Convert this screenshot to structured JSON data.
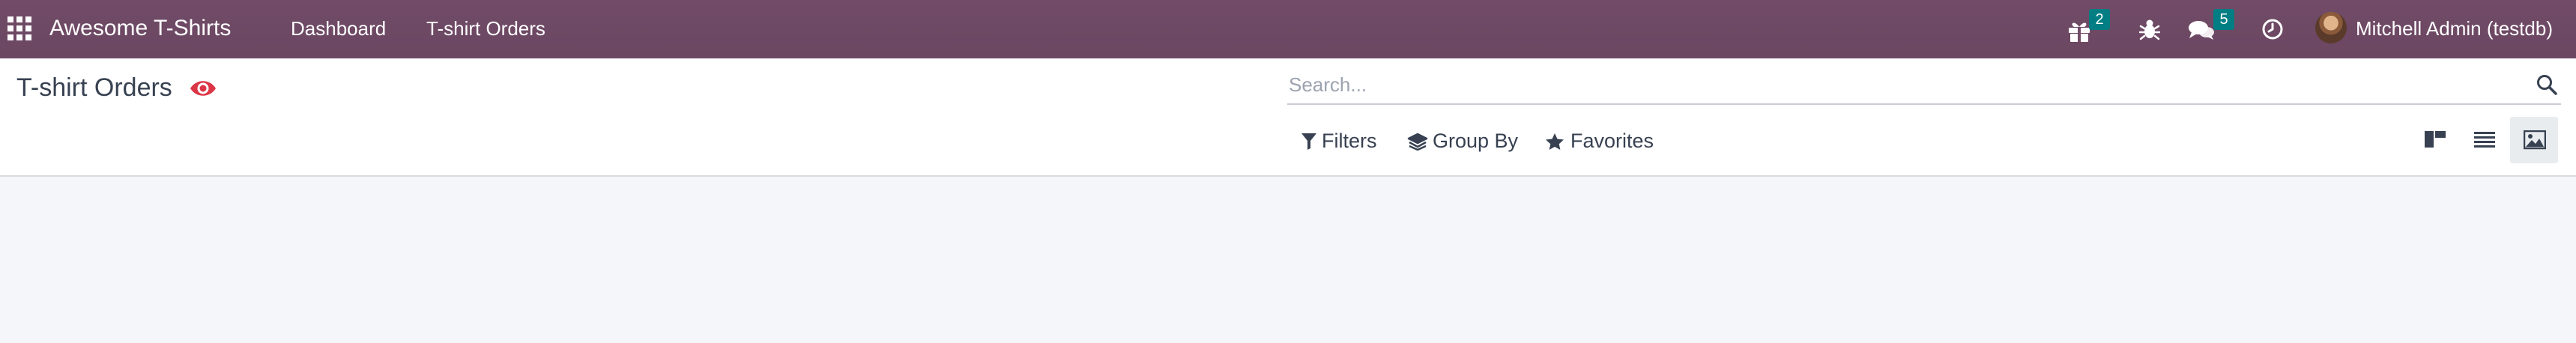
{
  "navbar": {
    "brand": "Awesome T-Shirts",
    "menus": [
      "Dashboard",
      "T-shirt Orders"
    ],
    "badges": {
      "gift": "2",
      "chat": "5"
    },
    "user": "Mitchell Admin (testdb)",
    "colors": {
      "background": "#714b67",
      "badge": "#017e84"
    },
    "icons": [
      "apps-grid-icon",
      "gift-icon",
      "bug-icon",
      "chat-icon",
      "clock-icon",
      "avatar"
    ]
  },
  "control_panel": {
    "breadcrumb": "T-shirt Orders",
    "search": {
      "placeholder": "Search...",
      "value": ""
    },
    "buttons": {
      "filters": "Filters",
      "group_by": "Group By",
      "favorites": "Favorites"
    },
    "views": [
      "kanban",
      "list",
      "image"
    ],
    "active_view": "image",
    "eye_color": "#dc3545"
  }
}
